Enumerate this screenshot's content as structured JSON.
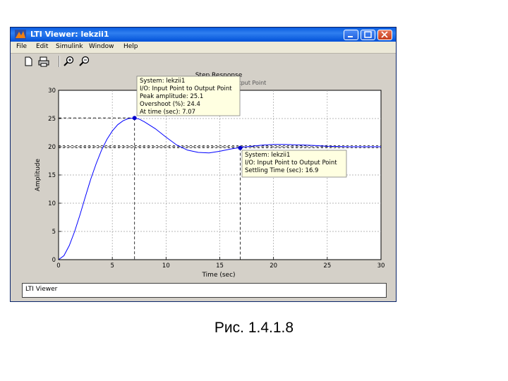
{
  "window": {
    "title": "LTI Viewer: lekzii1",
    "menu": [
      {
        "id": "file",
        "label": "File"
      },
      {
        "id": "edit",
        "label": "Edit"
      },
      {
        "id": "simulink",
        "label": "Simulink"
      },
      {
        "id": "window",
        "label": "Window"
      },
      {
        "id": "help",
        "label": "Help"
      }
    ],
    "toolbar": [
      {
        "id": "new",
        "icon": "new-file-icon"
      },
      {
        "id": "print",
        "icon": "printer-icon"
      },
      {
        "id": "zoom-in",
        "icon": "zoom-in-icon"
      },
      {
        "id": "zoom-out",
        "icon": "zoom-out-icon"
      }
    ],
    "status_text": "LTI Viewer"
  },
  "chart_data": {
    "type": "line",
    "title": "Step Response",
    "subtitle": "From: Input Point   To: Output Point",
    "xlabel": "Time (sec)",
    "ylabel": "Amplitude",
    "xlim": [
      0,
      30
    ],
    "ylim": [
      0,
      30
    ],
    "xticks": [
      0,
      5,
      10,
      15,
      20,
      25,
      30
    ],
    "yticks": [
      0,
      5,
      10,
      15,
      20,
      25,
      30
    ],
    "grid": true,
    "line_color": "#0000ff",
    "series": [
      {
        "x": [
          0,
          0.5,
          1,
          1.5,
          2,
          2.5,
          3,
          3.5,
          4,
          4.5,
          5,
          5.5,
          6,
          6.5,
          7.07,
          7.5,
          8,
          9,
          10,
          11,
          12,
          13,
          14,
          15,
          16,
          17,
          18,
          19,
          20,
          21,
          22,
          23,
          24,
          25,
          26,
          27,
          28,
          29,
          30
        ],
        "y": [
          0,
          0.7,
          2.5,
          5.0,
          8.0,
          11.2,
          14.3,
          17.0,
          19.4,
          21.3,
          22.8,
          23.9,
          24.6,
          25.0,
          25.1,
          24.9,
          24.4,
          23.2,
          21.7,
          20.3,
          19.4,
          19.0,
          18.9,
          19.2,
          19.6,
          19.9,
          20.1,
          20.3,
          20.4,
          20.4,
          20.35,
          20.3,
          20.2,
          20.1,
          20.05,
          20.0,
          20.0,
          20.0,
          20.0
        ]
      }
    ],
    "reference_lines": {
      "final_value": 20,
      "settling_band": [
        19.8,
        20.2
      ],
      "peak_value": 25.1
    },
    "peak_marker": {
      "x": 7.07,
      "y": 25.1
    },
    "settling_marker": {
      "x": 16.9,
      "y": 19.8
    },
    "peak_tooltip": {
      "system": "System: lekzii1",
      "io": "I/O: Input Point to Output Point",
      "peak": "Peak amplitude: 25.1",
      "overshoot": "Overshoot (%): 24.4",
      "time": "At time (sec): 7.07"
    },
    "settling_tooltip": {
      "system": "System: lekzii1",
      "io": "I/O: Input Point to Output Point",
      "settling": "Settling Time (sec): 16.9"
    }
  },
  "caption": "Рис. 1.4.1.8"
}
